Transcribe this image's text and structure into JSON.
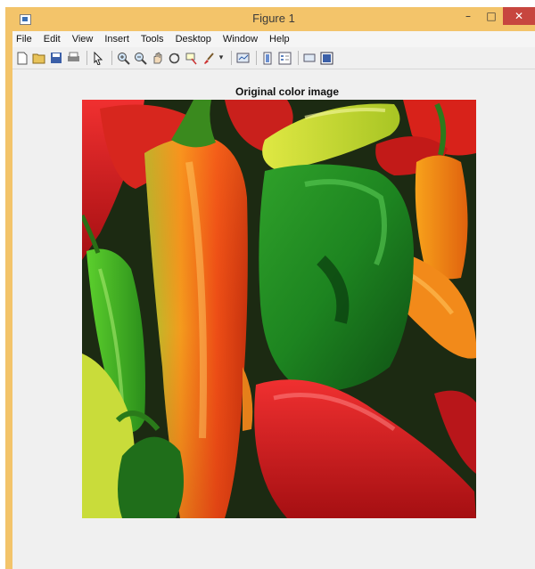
{
  "window": {
    "title": "Figure 1",
    "accent_color": "#f3c46a",
    "close_color": "#c7463f",
    "buttons": {
      "minimize": "–",
      "maximize": "□",
      "close": "✕"
    }
  },
  "menubar": {
    "items": [
      "File",
      "Edit",
      "View",
      "Insert",
      "Tools",
      "Desktop",
      "Window",
      "Help"
    ]
  },
  "toolbar": {
    "icons": [
      "new-figure-icon",
      "open-file-icon",
      "save-icon",
      "print-icon",
      "select-arrow-icon",
      "zoom-in-icon",
      "zoom-out-icon",
      "pan-icon",
      "rotate-3d-icon",
      "data-cursor-icon",
      "brush-icon",
      "brush-dropdown-icon",
      "link-plot-icon",
      "colorbar-icon",
      "legend-icon",
      "hide-plot-tools-icon",
      "show-plot-tools-icon"
    ]
  },
  "figure": {
    "title": "Original color image",
    "image_subject": "peppers photograph"
  }
}
